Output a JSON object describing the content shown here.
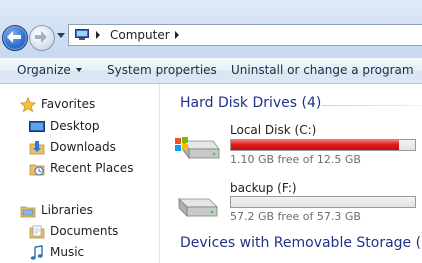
{
  "address_bar": {
    "crumb": "Computer"
  },
  "toolbar": {
    "organize": "Organize",
    "system_properties": "System properties",
    "uninstall": "Uninstall or change a program"
  },
  "navigation": {
    "favorites": {
      "label": "Favorites",
      "items": [
        {
          "label": "Desktop",
          "icon": "desktop-icon"
        },
        {
          "label": "Downloads",
          "icon": "downloads-folder-icon"
        },
        {
          "label": "Recent Places",
          "icon": "recent-places-icon"
        }
      ]
    },
    "libraries": {
      "label": "Libraries",
      "items": [
        {
          "label": "Documents",
          "icon": "documents-library-icon"
        },
        {
          "label": "Music",
          "icon": "music-library-icon"
        }
      ]
    }
  },
  "content": {
    "hard_disk_group": "Hard Disk Drives (4)",
    "removable_group": "Devices with Removable Storage (1)",
    "drives": [
      {
        "name": "Local Disk (C:)",
        "free_text": "1.10 GB free of 12.5 GB",
        "used_fraction": 0.912,
        "bar_color": "#d91515",
        "icon": "system-drive-icon"
      },
      {
        "name": "backup (F:)",
        "free_text": "57.2 GB free of 57.3 GB",
        "used_fraction": 0.002,
        "bar_color": "#2a8ed8",
        "icon": "hard-drive-icon"
      }
    ]
  },
  "colors": {
    "group_header": "#1e3287",
    "low_space": "#d91515"
  }
}
